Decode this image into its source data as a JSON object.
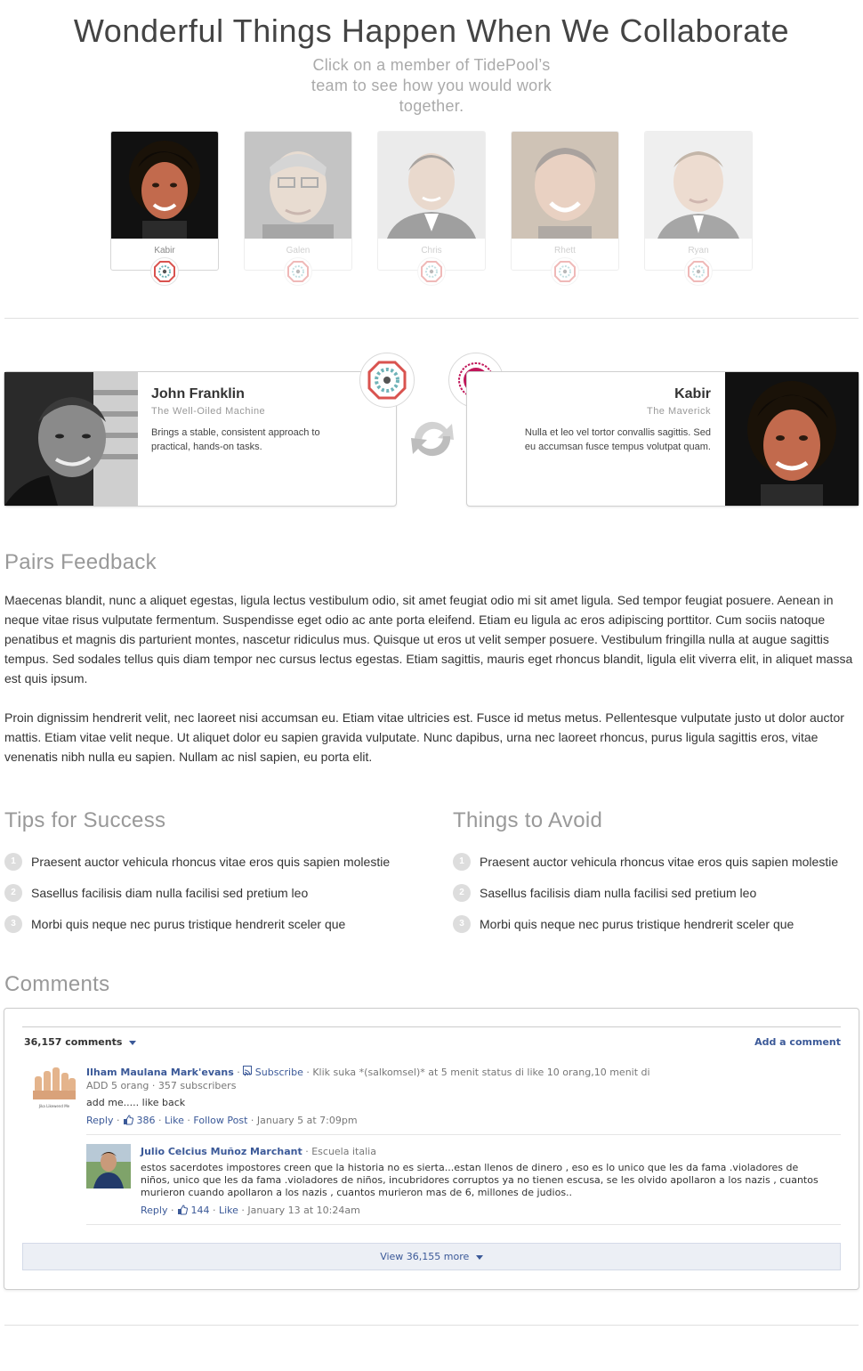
{
  "hero": {
    "title": "Wonderful Things Happen When We Collaborate",
    "subtitle": "Click on a member of TidePool’s team to see how you would work together."
  },
  "team": [
    {
      "name": "Kabir",
      "selected": true
    },
    {
      "name": "Galen",
      "selected": false
    },
    {
      "name": "Chris",
      "selected": false
    },
    {
      "name": "Rhett",
      "selected": false
    },
    {
      "name": "Ryan",
      "selected": false
    }
  ],
  "pair": {
    "left": {
      "name": "John Franklin",
      "role": "The Well-Oiled Machine",
      "description": "Brings a stable, consistent approach to practical, hands-on tasks."
    },
    "right": {
      "name": "Kabir",
      "role": "The Maverick",
      "description": "Nulla et leo vel tortor convallis sagittis. Sed eu accumsan fusce tempus volutpat quam."
    }
  },
  "feedback": {
    "title": "Pairs Feedback",
    "paragraphs": [
      "Maecenas blandit, nunc a aliquet egestas, ligula lectus vestibulum odio, sit amet feugiat odio mi sit amet ligula. Sed tempor feugiat posuere. Aenean in neque vitae risus vulputate fermentum. Suspendisse eget odio ac ante porta eleifend. Etiam eu ligula ac eros adipiscing porttitor. Cum sociis natoque penatibus et magnis dis parturient montes, nascetur ridiculus mus. Quisque ut eros ut velit semper posuere. Vestibulum fringilla nulla at augue sagittis tempus. Sed sodales tellus quis diam tempor nec cursus lectus egestas. Etiam sagittis, mauris eget rhoncus blandit, ligula elit viverra elit, in aliquet massa est quis ipsum.",
      "Proin dignissim hendrerit velit, nec laoreet nisi accumsan eu. Etiam vitae ultricies est. Fusce id metus metus. Pellentesque vulputate justo ut dolor auctor mattis. Etiam vitae velit neque. Ut aliquet dolor eu sapien gravida vulputate. Nunc dapibus, urna nec laoreet rhoncus, purus ligula sagittis eros, vitae venenatis nibh nulla eu sapien. Nullam ac nisl sapien, eu porta elit."
    ]
  },
  "tips": {
    "title": "Tips for Success",
    "items": [
      {
        "num": "1",
        "text": "Praesent auctor vehicula rhoncus vitae eros quis sapien molestie"
      },
      {
        "num": "2",
        "text": "Sasellus facilisis diam nulla facilisi sed pretium leo"
      },
      {
        "num": "3",
        "text": "Morbi quis neque nec purus tristique hendrerit sceler que"
      }
    ]
  },
  "avoid": {
    "title": "Things to Avoid",
    "items": [
      {
        "num": "1",
        "text": "Praesent auctor vehicula rhoncus vitae eros quis sapien molestie"
      },
      {
        "num": "2",
        "text": "Sasellus facilisis diam nulla facilisi sed pretium leo"
      },
      {
        "num": "3",
        "text": "Morbi quis neque nec purus tristique hendrerit sceler que"
      }
    ]
  },
  "comments": {
    "title": "Comments",
    "count_label": "36,157 comments",
    "add_label": "Add a comment",
    "view_more": "View 36,155 more",
    "items": [
      {
        "author": "Ilham Maulana Mark'evans",
        "subscribe": "Subscribe",
        "tagline": "· Klik suka *(salkomsel)* at 5 menit status di like 10 orang,10 menit di",
        "subline": "ADD 5 orang · 357 subscribers",
        "body": "add me..... like back",
        "reply": "Reply",
        "likes": "386",
        "like": "Like",
        "follow": "Follow Post",
        "date": "· January 5 at 7:09pm"
      },
      {
        "author": "Julio Celcius Muñoz Marchant",
        "tagline": "· Escuela italia",
        "body": "estos sacerdotes impostores creen que la historia no es sierta...estan llenos de dinero , eso es lo unico que les da fama .violadores de niños, unico que les da fama .violadores de niños, incubridores corruptos ya no tienen escusa, se les olvido apollaron a los nazis , cuantos murieron cuando apollaron a los nazis , cuantos murieron mas de 6, millones de judios..",
        "reply": "Reply",
        "likes": "144",
        "like": "Like",
        "date": "· January 13 at 10:24am"
      }
    ]
  },
  "colors": {
    "accent_red": "#d9534f",
    "facebook_blue": "#3b5998",
    "muted_text": "#999999"
  }
}
